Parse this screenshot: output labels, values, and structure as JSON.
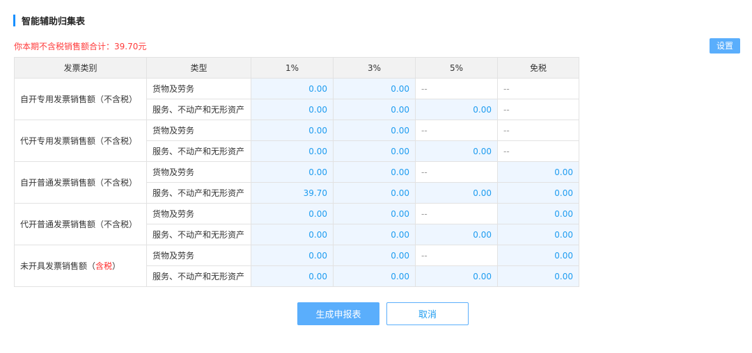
{
  "page": {
    "title": "智能辅助归集表",
    "summary": "你本期不含税销售额合计：39.70元"
  },
  "buttons": {
    "settings": "设置",
    "generate": "生成申报表",
    "cancel": "取消"
  },
  "colors": {
    "accent": "#1890ff",
    "button": "#5aaefc",
    "value_text": "#1e9cf0",
    "value_bg": "#eef6ff",
    "summary_text": "#ff3a3a"
  },
  "table": {
    "headers": [
      "发票类别",
      "类型",
      "1%",
      "3%",
      "5%",
      "免税"
    ],
    "categories": [
      {
        "name": "自开专用发票销售额（不含税）",
        "rows": [
          {
            "type": "货物及劳务",
            "values": [
              "0.00",
              "0.00",
              "--",
              "--"
            ]
          },
          {
            "type": "服务、不动产和无形资产",
            "values": [
              "0.00",
              "0.00",
              "0.00",
              "--"
            ]
          }
        ]
      },
      {
        "name": "代开专用发票销售额（不含税）",
        "rows": [
          {
            "type": "货物及劳务",
            "values": [
              "0.00",
              "0.00",
              "--",
              "--"
            ]
          },
          {
            "type": "服务、不动产和无形资产",
            "values": [
              "0.00",
              "0.00",
              "0.00",
              "--"
            ]
          }
        ]
      },
      {
        "name": "自开普通发票销售额（不含税）",
        "rows": [
          {
            "type": "货物及劳务",
            "values": [
              "0.00",
              "0.00",
              "--",
              "0.00"
            ]
          },
          {
            "type": "服务、不动产和无形资产",
            "values": [
              "39.70",
              "0.00",
              "0.00",
              "0.00"
            ]
          }
        ]
      },
      {
        "name": "代开普通发票销售额（不含税）",
        "rows": [
          {
            "type": "货物及劳务",
            "values": [
              "0.00",
              "0.00",
              "--",
              "0.00"
            ]
          },
          {
            "type": "服务、不动产和无形资产",
            "values": [
              "0.00",
              "0.00",
              "0.00",
              "0.00"
            ]
          }
        ]
      },
      {
        "name_prefix": "未开具发票销售额（",
        "name_highlight": "含税",
        "name_suffix": "）",
        "rows": [
          {
            "type": "货物及劳务",
            "values": [
              "0.00",
              "0.00",
              "--",
              "0.00"
            ]
          },
          {
            "type": "服务、不动产和无形资产",
            "values": [
              "0.00",
              "0.00",
              "0.00",
              "0.00"
            ]
          }
        ]
      }
    ]
  }
}
